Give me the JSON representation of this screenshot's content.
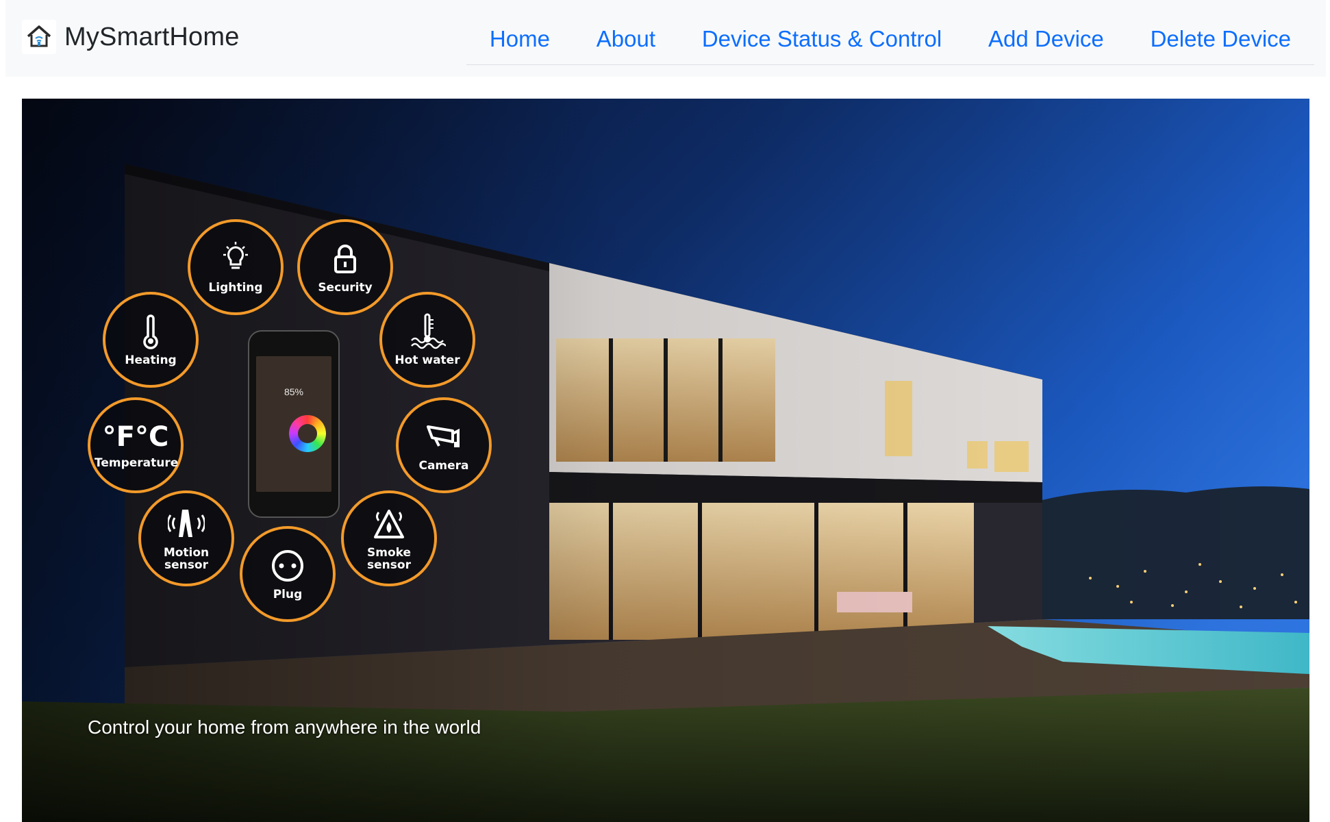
{
  "navbar": {
    "brand_name": "MySmartHome",
    "logo_icon": "smart-home-logo-icon",
    "links": [
      {
        "label": "Home"
      },
      {
        "label": "About"
      },
      {
        "label": "Device Status & Control"
      },
      {
        "label": "Add Device"
      },
      {
        "label": "Delete Device"
      }
    ],
    "link_color": "#0d6efd"
  },
  "hero": {
    "caption": "Control your home from anywhere in the world",
    "features": [
      {
        "label": "Lighting",
        "icon": "lightbulb-icon"
      },
      {
        "label": "Security",
        "icon": "padlock-icon"
      },
      {
        "label": "Heating",
        "icon": "thermometer-icon"
      },
      {
        "label": "Hot water",
        "icon": "hot-water-icon"
      },
      {
        "label": "Temperature",
        "icon": "celsius-fahrenheit-icon",
        "glyph": "°F°C"
      },
      {
        "label": "Camera",
        "icon": "camera-icon"
      },
      {
        "label": "Motion sensor",
        "icon": "motion-sensor-icon"
      },
      {
        "label": "Plug",
        "icon": "plug-icon"
      },
      {
        "label": "Smoke sensor",
        "icon": "smoke-sensor-icon"
      }
    ],
    "phone_percentage": "85%",
    "accent_color": "#f39a2a"
  }
}
